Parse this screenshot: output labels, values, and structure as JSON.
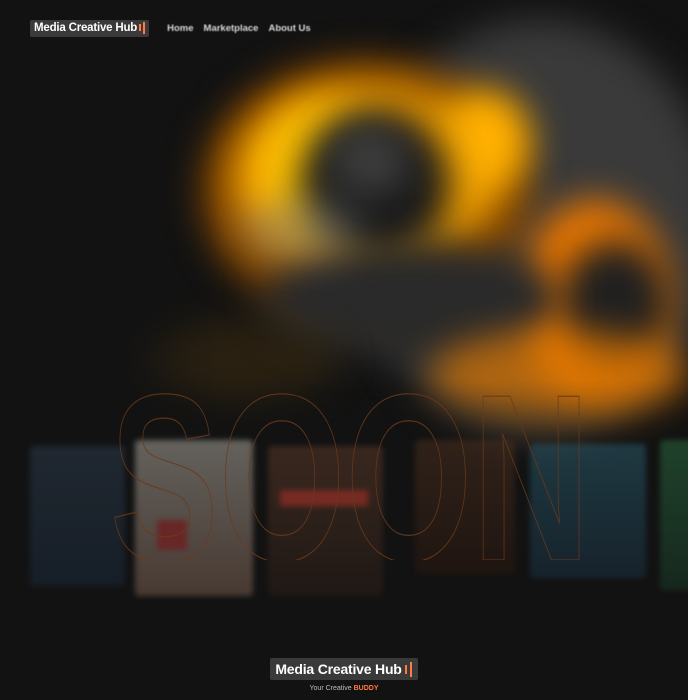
{
  "header": {
    "logo_text": "Media Creative Hub",
    "nav": [
      {
        "label": "Home"
      },
      {
        "label": "Marketplace"
      },
      {
        "label": "About Us"
      }
    ]
  },
  "hero": {
    "background_word": "SOON"
  },
  "footer": {
    "logo_text": "Media Creative Hub",
    "tagline_prefix": "Your Creative",
    "tagline_accent": "BUDDY"
  },
  "colors": {
    "background": "#121212",
    "accent": "#ff7a45",
    "badge": "#3a3a3a",
    "swirl_orange": "#f08a00"
  }
}
